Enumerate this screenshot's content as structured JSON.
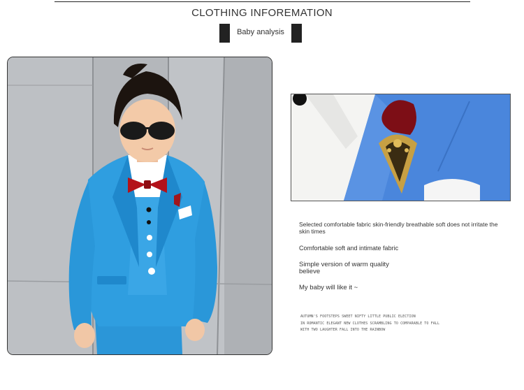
{
  "header": {
    "title": "CLOTHING INFOREMATION",
    "subtitle": "Baby analysis"
  },
  "features": [
    "Selected comfortable fabric skin-friendly breathable soft does not irritate the skin times",
    "Comfortable soft and intimate fabric",
    "Simple version of warm quality believe",
    "My baby will like it ~"
  ],
  "fine_print": [
    "AUTUMN'S FOOTSTEPS SWEET NIFTY LITTLE PUBLIC ELECTION",
    "IN ROMANTIC ELEGANT NEW CLOTHES SCRAMBLING TO COMPARABLE TO FALL",
    "WITH TWO LAUGHTER FALL INTO THE RAINBOW"
  ],
  "colors": {
    "suit_blue": "#2f9ee0",
    "bow_tie_red": "#b3121a",
    "accent_dark": "#222222"
  }
}
